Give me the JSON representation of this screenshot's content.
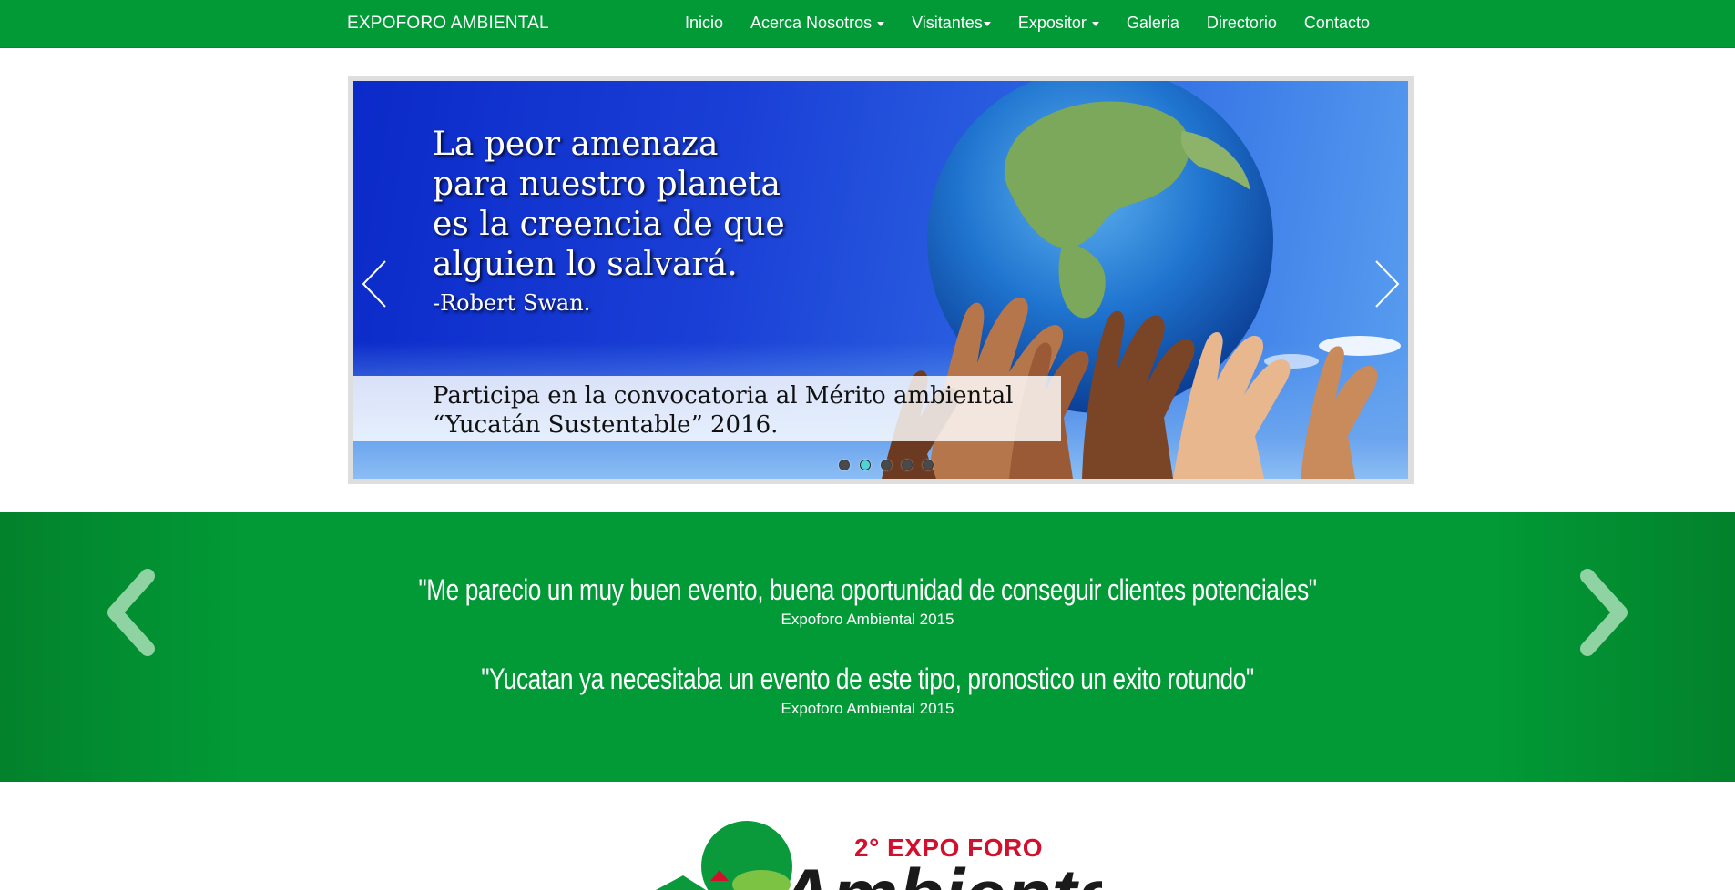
{
  "navbar": {
    "brand": "EXPOFORO AMBIENTAL",
    "items": [
      {
        "label": "Inicio",
        "dropdown": false
      },
      {
        "label": "Acerca Nosotros",
        "dropdown": true
      },
      {
        "label": "Visitantes",
        "dropdown": true
      },
      {
        "label": "Expositor",
        "dropdown": true
      },
      {
        "label": "Galeria",
        "dropdown": false
      },
      {
        "label": "Directorio",
        "dropdown": false
      },
      {
        "label": "Contacto",
        "dropdown": false
      }
    ]
  },
  "slider": {
    "quote_lines": [
      "La peor amenaza",
      "para nuestro planeta",
      "es la creencia de que",
      "alguien lo salvará."
    ],
    "author": "-Robert Swan.",
    "banner_lines": [
      "Participa en la convocatoria al Mérito ambiental",
      "“Yucatán Sustentable” 2016."
    ],
    "slide_count": 5,
    "active_slide": 2,
    "prev_icon": "chevron-left-icon",
    "next_icon": "chevron-right-icon"
  },
  "testimonials": {
    "items": [
      {
        "quote": "\"Me parecio un muy buen evento, buena oportunidad de conseguir clientes potenciales\"",
        "source": "Expoforo Ambiental 2015"
      },
      {
        "quote": "\"Yucatan ya necesitaba un evento de este tipo, pronostico un exito rotundo\"",
        "source": "Expoforo Ambiental 2015"
      }
    ],
    "prev_icon": "chevron-left-icon",
    "next_icon": "chevron-right-icon"
  },
  "logo": {
    "title": "2° EXPO FORO",
    "word": "Ambiental"
  },
  "colors": {
    "brand_green": "#019a36",
    "logo_red": "#d0102c",
    "slide_blue": "#1a3fd6"
  }
}
